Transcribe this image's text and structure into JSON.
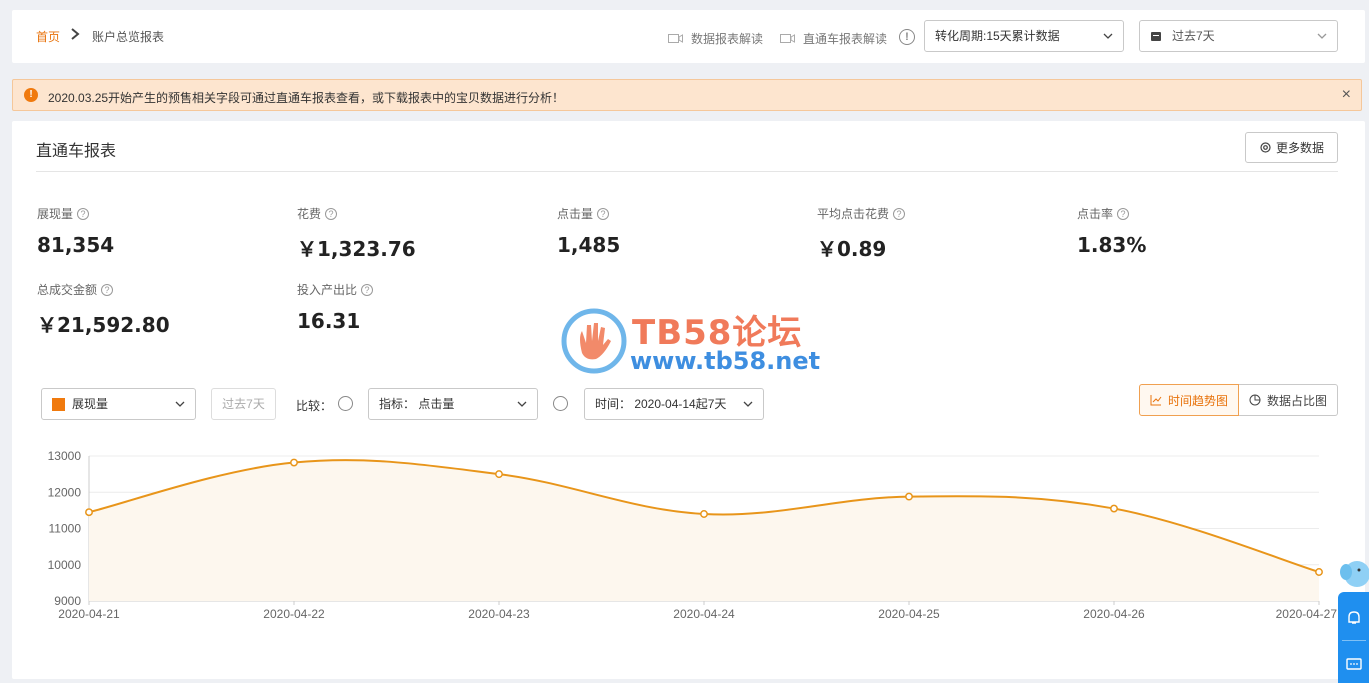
{
  "breadcrumb": {
    "home": "首页",
    "current": "账户总览报表"
  },
  "header_links": {
    "data_report_interp": "数据报表解读",
    "ztc_report_interp": "直通车报表解读"
  },
  "period_select": {
    "value": "转化周期:15天累计数据"
  },
  "date_select": {
    "value": "过去7天"
  },
  "notice": {
    "text": "2020.03.25开始产生的预售相关字段可通过直通车报表查看，或下载报表中的宝贝数据进行分析！",
    "close": "×",
    "icon": "!"
  },
  "report": {
    "title": "直通车报表",
    "more_button": "更多数据",
    "metrics": [
      {
        "label": "展现量",
        "value": "81,354"
      },
      {
        "label": "花费",
        "value": "￥1,323.76"
      },
      {
        "label": "点击量",
        "value": "1,485"
      },
      {
        "label": "平均点击花费",
        "value": "￥0.89"
      },
      {
        "label": "点击率",
        "value": "1.83%"
      },
      {
        "label": "总成交金额",
        "value": "￥21,592.80"
      },
      {
        "label": "投入产出比",
        "value": "16.31"
      }
    ]
  },
  "controls": {
    "metric_select": "展现量",
    "past7_button": "过去7天",
    "compare_label": "比较：",
    "indicator_select": "指标：  点击量",
    "time_select": "时间：  2020-04-14起7天",
    "tab_trend": "时间趋势图",
    "tab_ratio": "数据占比图"
  },
  "watermark": {
    "title": "TB58论坛",
    "url": "www.tb58.net"
  },
  "colors": {
    "accent": "#e8730c",
    "line": "#e8951a",
    "notice_bg": "#fde5cf"
  },
  "chart_data": {
    "type": "area",
    "x": [
      "2020-04-21",
      "2020-04-22",
      "2020-04-23",
      "2020-04-24",
      "2020-04-25",
      "2020-04-26",
      "2020-04-27"
    ],
    "series": [
      {
        "values": [
          11450,
          12820,
          12500,
          11400,
          11880,
          11550,
          9800
        ]
      }
    ],
    "yticks": [
      "13000",
      "12000",
      "11000",
      "10000",
      "9000"
    ],
    "ylim": [
      9000,
      13000
    ],
    "grid": true
  }
}
